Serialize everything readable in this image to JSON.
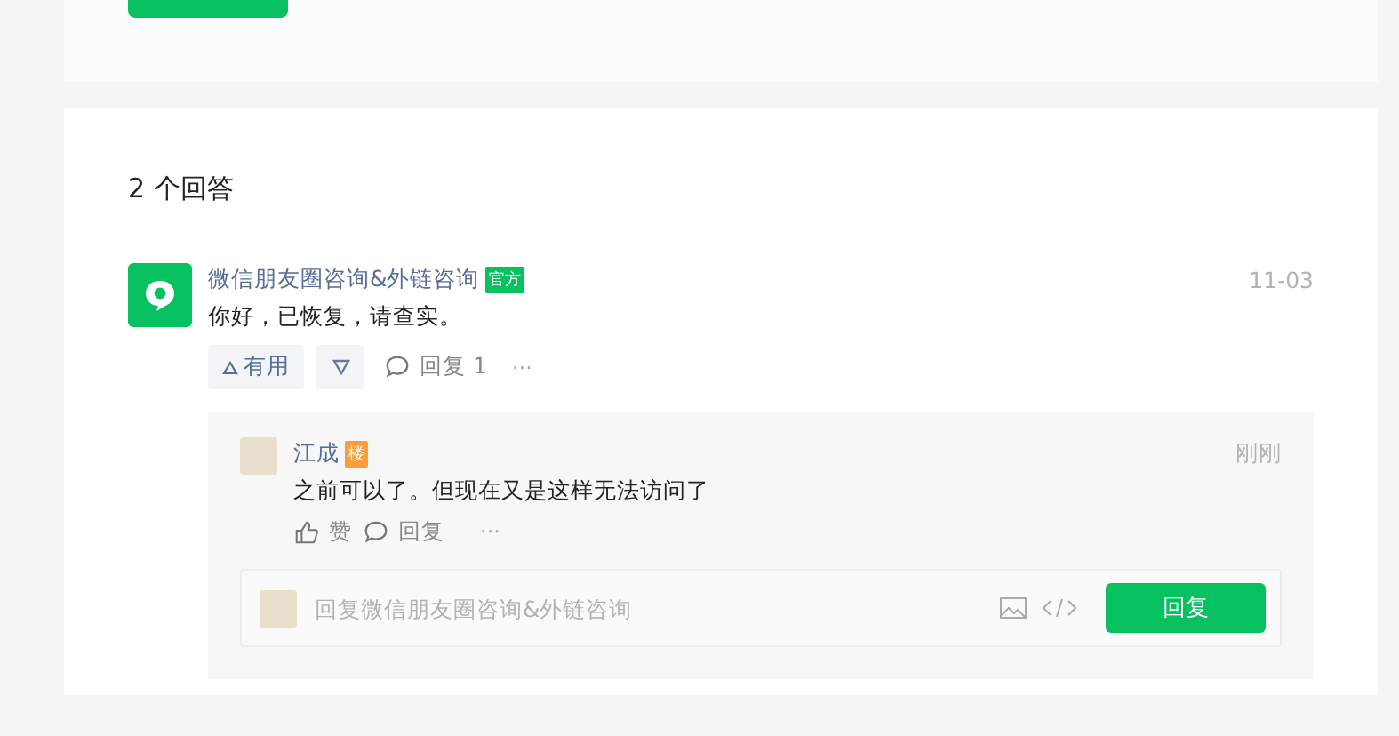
{
  "answers_heading": "2 个回答",
  "answer": {
    "author": "微信朋友圈咨询&外链咨询",
    "badge": "官方",
    "time": "11-03",
    "text": "你好，已恢复，请查实。",
    "useful_label": "有用",
    "reply_label": "回复 1",
    "more": "···"
  },
  "comment": {
    "author": "江成",
    "badge": "楼",
    "time": "刚刚",
    "text": "之前可以了。但现在又是这样无法访问了",
    "like_label": "赞",
    "reply_label": "回复",
    "more": "···"
  },
  "reply_box": {
    "placeholder": "回复微信朋友圈咨询&外链咨询",
    "submit": "回复"
  }
}
